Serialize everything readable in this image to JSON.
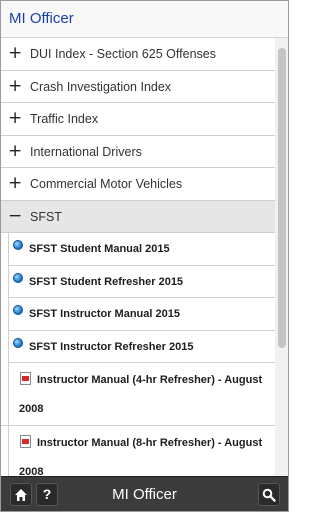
{
  "app": {
    "title": "MI Officer"
  },
  "categories": [
    {
      "sign": "+",
      "label": "DUI Index - Section 625 Offenses"
    },
    {
      "sign": "+",
      "label": "Crash Investigation Index"
    },
    {
      "sign": "+",
      "label": "Traffic Index"
    },
    {
      "sign": "+",
      "label": "International Drivers"
    },
    {
      "sign": "+",
      "label": "Commercial Motor Vehicles"
    },
    {
      "sign": "−",
      "label": "SFST"
    }
  ],
  "sfst_items": {
    "web": [
      {
        "label": "SFST Student Manual 2015",
        "icon": "globe-icon"
      },
      {
        "label": "SFST Student Refresher 2015",
        "icon": "globe-icon"
      },
      {
        "label": "SFST Instructor Manual 2015",
        "icon": "globe-icon"
      },
      {
        "label": "SFST Instructor Refresher 2015",
        "icon": "globe-icon"
      }
    ],
    "pdf": [
      {
        "line1": "Instructor Manual (4-hr Refresher) - August",
        "line2": "2008",
        "icon": "pdf-icon"
      },
      {
        "line1": "Instructor Manual (8-hr Refresher) - August",
        "line2": "2008",
        "icon": "pdf-icon"
      }
    ]
  },
  "footer": {
    "title": "MI Officer",
    "help_label": "?"
  },
  "colors": {
    "title_blue": "#1a3fa8",
    "footer_bg": "#3b3b3b",
    "expanded_bg": "#e6e6e6"
  }
}
